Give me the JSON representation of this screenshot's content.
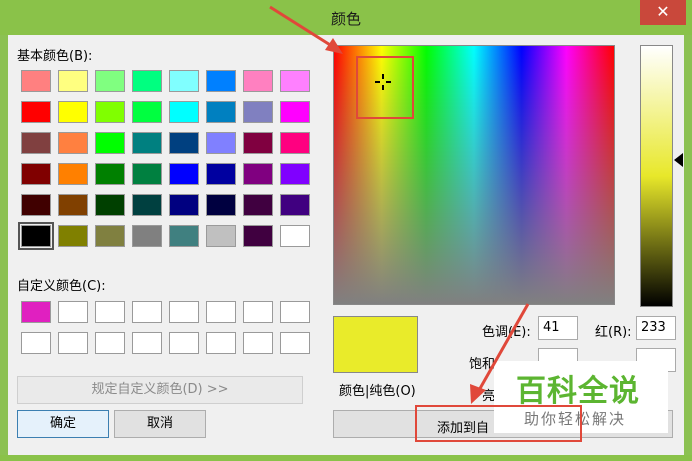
{
  "window": {
    "title": "颜色",
    "close_glyph": "✕"
  },
  "basic_colors": {
    "label": "基本颜色(B):",
    "swatches": [
      "#ff8080",
      "#ffff80",
      "#80ff80",
      "#00ff80",
      "#80ffff",
      "#0080ff",
      "#ff80c0",
      "#ff80ff",
      "#ff0000",
      "#ffff00",
      "#80ff00",
      "#00ff40",
      "#00ffff",
      "#0080c0",
      "#8080c0",
      "#ff00ff",
      "#804040",
      "#ff8040",
      "#00ff00",
      "#008080",
      "#004080",
      "#8080ff",
      "#800040",
      "#ff0080",
      "#800000",
      "#ff8000",
      "#008000",
      "#008040",
      "#0000ff",
      "#0000a0",
      "#800080",
      "#8000ff",
      "#400000",
      "#804000",
      "#004000",
      "#004040",
      "#000080",
      "#000040",
      "#400040",
      "#400080",
      "#000000",
      "#808000",
      "#808040",
      "#808080",
      "#408080",
      "#c0c0c0",
      "#400040",
      "#ffffff"
    ],
    "selected_index": 40
  },
  "custom_colors": {
    "label": "自定义颜色(C):",
    "swatches": [
      "#e020c0",
      "#ffffff",
      "#ffffff",
      "#ffffff",
      "#ffffff",
      "#ffffff",
      "#ffffff",
      "#ffffff",
      "#ffffff",
      "#ffffff",
      "#ffffff",
      "#ffffff",
      "#ffffff",
      "#ffffff",
      "#ffffff",
      "#ffffff"
    ]
  },
  "buttons": {
    "define_custom": "规定自定义颜色(D) >>",
    "ok": "确定",
    "cancel": "取消",
    "add_custom": "添加到自"
  },
  "preview": {
    "label": "颜色|纯色(O)",
    "color": "#e9eb2a"
  },
  "fields": {
    "hue_label": "色调(E):",
    "hue_value": "41",
    "sat_label": "饱和",
    "lum_label": "亮",
    "red_label": "红(R):",
    "red_value": "233"
  },
  "watermark": {
    "main": "百科全说",
    "sub": "助你轻松解决"
  },
  "colors": {
    "titlebar": "#8ac249",
    "annotation": "#e0483a",
    "watermark_green": "#5cb531"
  }
}
